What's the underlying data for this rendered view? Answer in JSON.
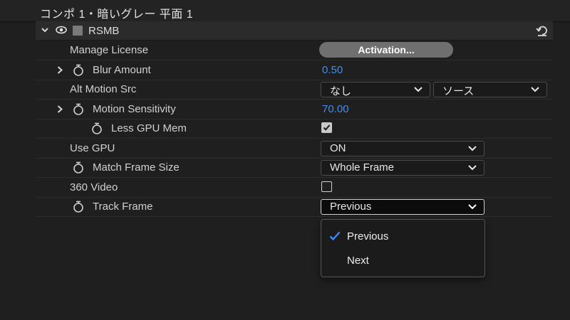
{
  "header": {
    "title": "コンポ 1・暗いグレー 平面 1"
  },
  "effect": {
    "name": "RSMB"
  },
  "properties": {
    "manage_license": {
      "label": "Manage License",
      "button": "Activation..."
    },
    "blur_amount": {
      "label": "Blur Amount",
      "value": "0.50"
    },
    "alt_motion_src": {
      "label": "Alt Motion Src",
      "select1": "なし",
      "select2": "ソース"
    },
    "motion_sensitivity": {
      "label": "Motion Sensitivity",
      "value": "70.00"
    },
    "less_gpu_mem": {
      "label": "Less GPU Mem",
      "checked": true
    },
    "use_gpu": {
      "label": "Use GPU",
      "value": "ON"
    },
    "match_frame_size": {
      "label": "Match Frame Size",
      "value": "Whole Frame"
    },
    "video_360": {
      "label": "360 Video",
      "checked": false
    },
    "track_frame": {
      "label": "Track Frame",
      "value": "Previous"
    }
  },
  "menu": {
    "items": [
      {
        "label": "Previous",
        "selected": true
      },
      {
        "label": "Next",
        "selected": false
      }
    ]
  },
  "colors": {
    "value_blue": "#3d8ef0",
    "check_blue": "#3a8cf0"
  }
}
